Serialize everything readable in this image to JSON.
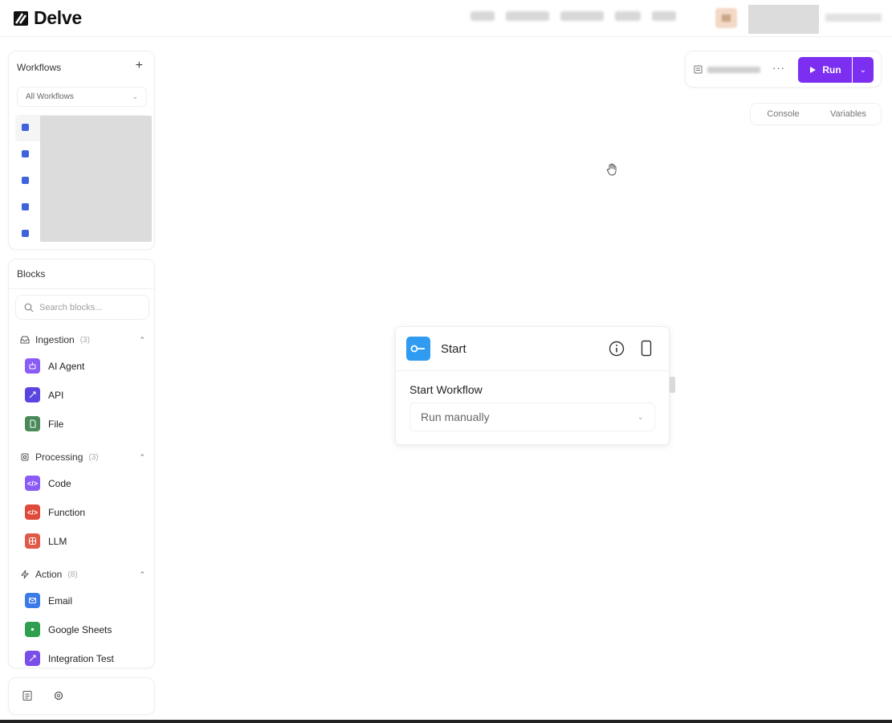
{
  "app": {
    "name": "Delve"
  },
  "sidebar": {
    "workflows": {
      "title": "Workflows",
      "add_label": "+",
      "filter": "All Workflows"
    },
    "blocks": {
      "title": "Blocks",
      "search_placeholder": "Search blocks...",
      "categories": [
        {
          "name": "Ingestion",
          "count": "(3)",
          "items": [
            {
              "label": "AI Agent",
              "color": "#8a5cf5"
            },
            {
              "label": "API",
              "color": "#5b45e0"
            },
            {
              "label": "File",
              "color": "#4a8a5a"
            }
          ]
        },
        {
          "name": "Processing",
          "count": "(3)",
          "items": [
            {
              "label": "Code",
              "color": "#8a5cf5"
            },
            {
              "label": "Function",
              "color": "#e04a3a"
            },
            {
              "label": "LLM",
              "color": "#e05a4a"
            }
          ]
        },
        {
          "name": "Action",
          "count": "(8)",
          "items": [
            {
              "label": "Email",
              "color": "#3b7be8"
            },
            {
              "label": "Google Sheets",
              "color": "#2e9e4f"
            },
            {
              "label": "Integration Test",
              "color": "#7a4ee8"
            }
          ]
        }
      ]
    }
  },
  "toolbar": {
    "more_label": "···",
    "run_label": "Run",
    "accent": "#7c2ff0",
    "tabs": [
      "Console",
      "Variables"
    ]
  },
  "node": {
    "title": "Start",
    "field_label": "Start Workflow",
    "field_value": "Run manually",
    "color": "#2f9cf2"
  }
}
